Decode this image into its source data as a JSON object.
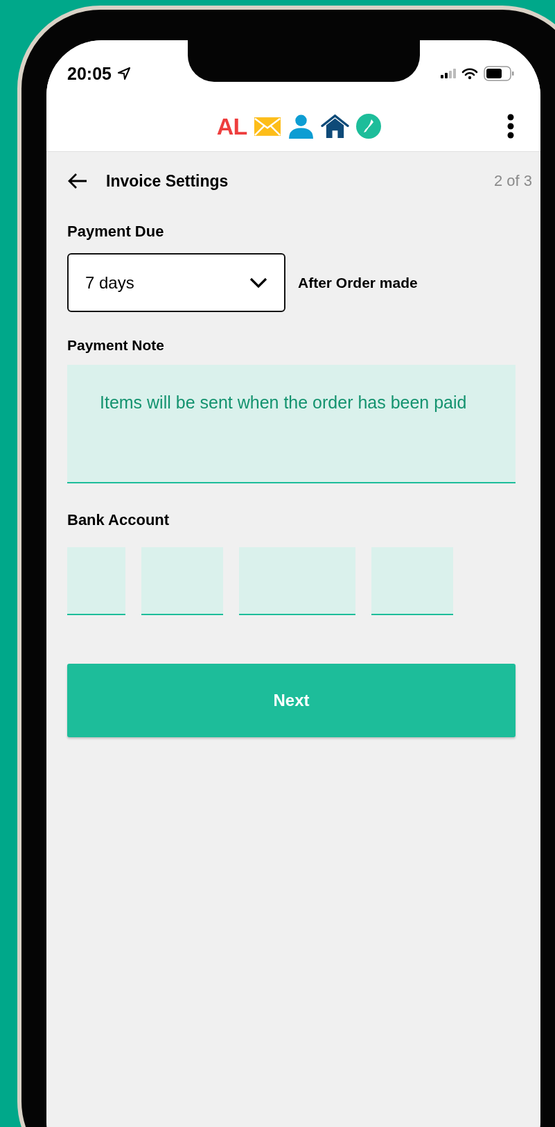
{
  "status_bar": {
    "time": "20:05"
  },
  "app_bar": {
    "logo": "AL"
  },
  "page": {
    "title": "Invoice Settings",
    "step": "2 of 3"
  },
  "payment_due": {
    "label": "Payment Due",
    "value": "7 days",
    "suffix": "After Order made"
  },
  "payment_note": {
    "label": "Payment Note",
    "value": "Items will be sent when the order has been paid"
  },
  "bank_account": {
    "label": "Bank Account",
    "fields": [
      {
        "kind": "short"
      },
      {
        "kind": "medium"
      },
      {
        "kind": "long"
      },
      {
        "kind": "medium"
      }
    ]
  },
  "buttons": [
    {
      "label": "Next"
    }
  ]
}
